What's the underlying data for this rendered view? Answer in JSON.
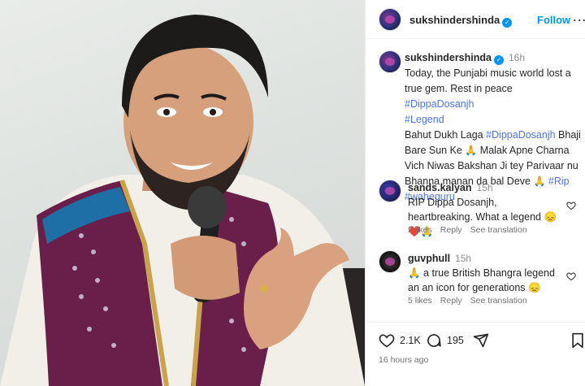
{
  "header": {
    "username": "sukshindershinda",
    "follow_label": "Follow",
    "more_label": "…"
  },
  "caption": {
    "username": "sukshindershinda",
    "time": "16h",
    "line1": "Today, the Punjabi music world  lost a true gem. Rest in peace ",
    "tag1": "#DippaDosanjh",
    "tag2": "#Legend",
    "line2a": "Bahut Dukh Laga ",
    "tag3": "#DippaDosanjh",
    "line2b": "  Bhaji Bare Sun Ke ",
    "emoji1": "🙏",
    "line2c": " Malak Apne Charna Vich Niwas Bakshan Ji tey Parivaar nu Bhanna manan da bal Deve ",
    "emoji2": "🙏",
    "tag4": "#Rip",
    "tag5": "#waheguru"
  },
  "comments": [
    {
      "username": "sands.kalyan",
      "time": "15h",
      "text": "RIP Dippa Dosanjh, heartbreaking. What a legend ",
      "emojis": "😞❤️🙏",
      "likes": "2 likes",
      "reply": "Reply",
      "translate": "See translation"
    },
    {
      "username": "guvphull",
      "time": "15h",
      "emoji_prefix": "🙏",
      "text": " a true British Bhangra legend an an icon for generations ",
      "emojis": "😞",
      "likes": "5 likes",
      "reply": "Reply",
      "translate": "See translation"
    }
  ],
  "actions": {
    "like_count": "2.1K",
    "comment_count": "195",
    "posted_ago": "16 hours ago"
  },
  "colors": {
    "link": "#4a73ff",
    "follow": "#0095f6",
    "muted": "#737373"
  }
}
